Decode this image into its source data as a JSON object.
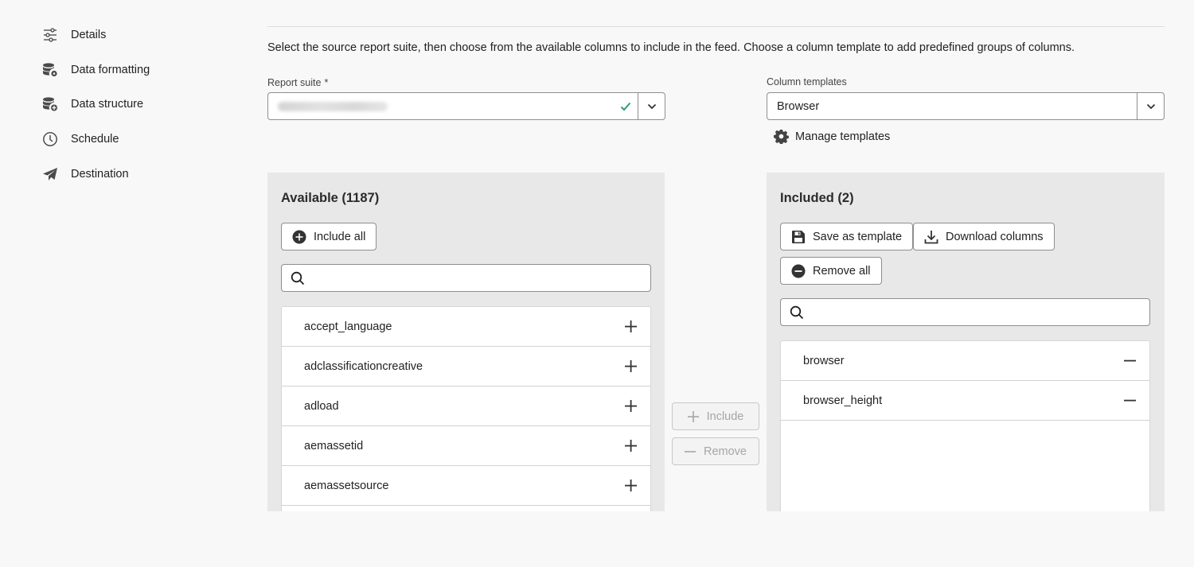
{
  "sidebar": {
    "items": [
      {
        "label": "Details",
        "icon": "sliders-icon"
      },
      {
        "label": "Data formatting",
        "icon": "database-gear-icon"
      },
      {
        "label": "Data structure",
        "icon": "database-add-icon"
      },
      {
        "label": "Schedule",
        "icon": "clock-icon"
      },
      {
        "label": "Destination",
        "icon": "paper-plane-icon"
      }
    ]
  },
  "main": {
    "description": "Select the source report suite, then choose from the available columns to include in the feed. Choose a column template to add predefined groups of columns.",
    "report_suite": {
      "label": "Report suite",
      "required_mark": "*",
      "valid_color": "#2d9d78"
    },
    "column_templates": {
      "label": "Column templates",
      "value": "Browser"
    },
    "manage_templates_label": "Manage templates"
  },
  "available": {
    "title": "Available (1187)",
    "include_all_label": "Include all",
    "search_placeholder": "",
    "items": [
      "accept_language",
      "adclassificationcreative",
      "adload",
      "aemassetid",
      "aemassetsource"
    ]
  },
  "transfer": {
    "include_label": "Include",
    "remove_label": "Remove"
  },
  "included": {
    "title": "Included (2)",
    "save_template_label": "Save as template",
    "download_columns_label": "Download columns",
    "remove_all_label": "Remove all",
    "search_placeholder": "",
    "items": [
      "browser",
      "browser_height"
    ]
  }
}
